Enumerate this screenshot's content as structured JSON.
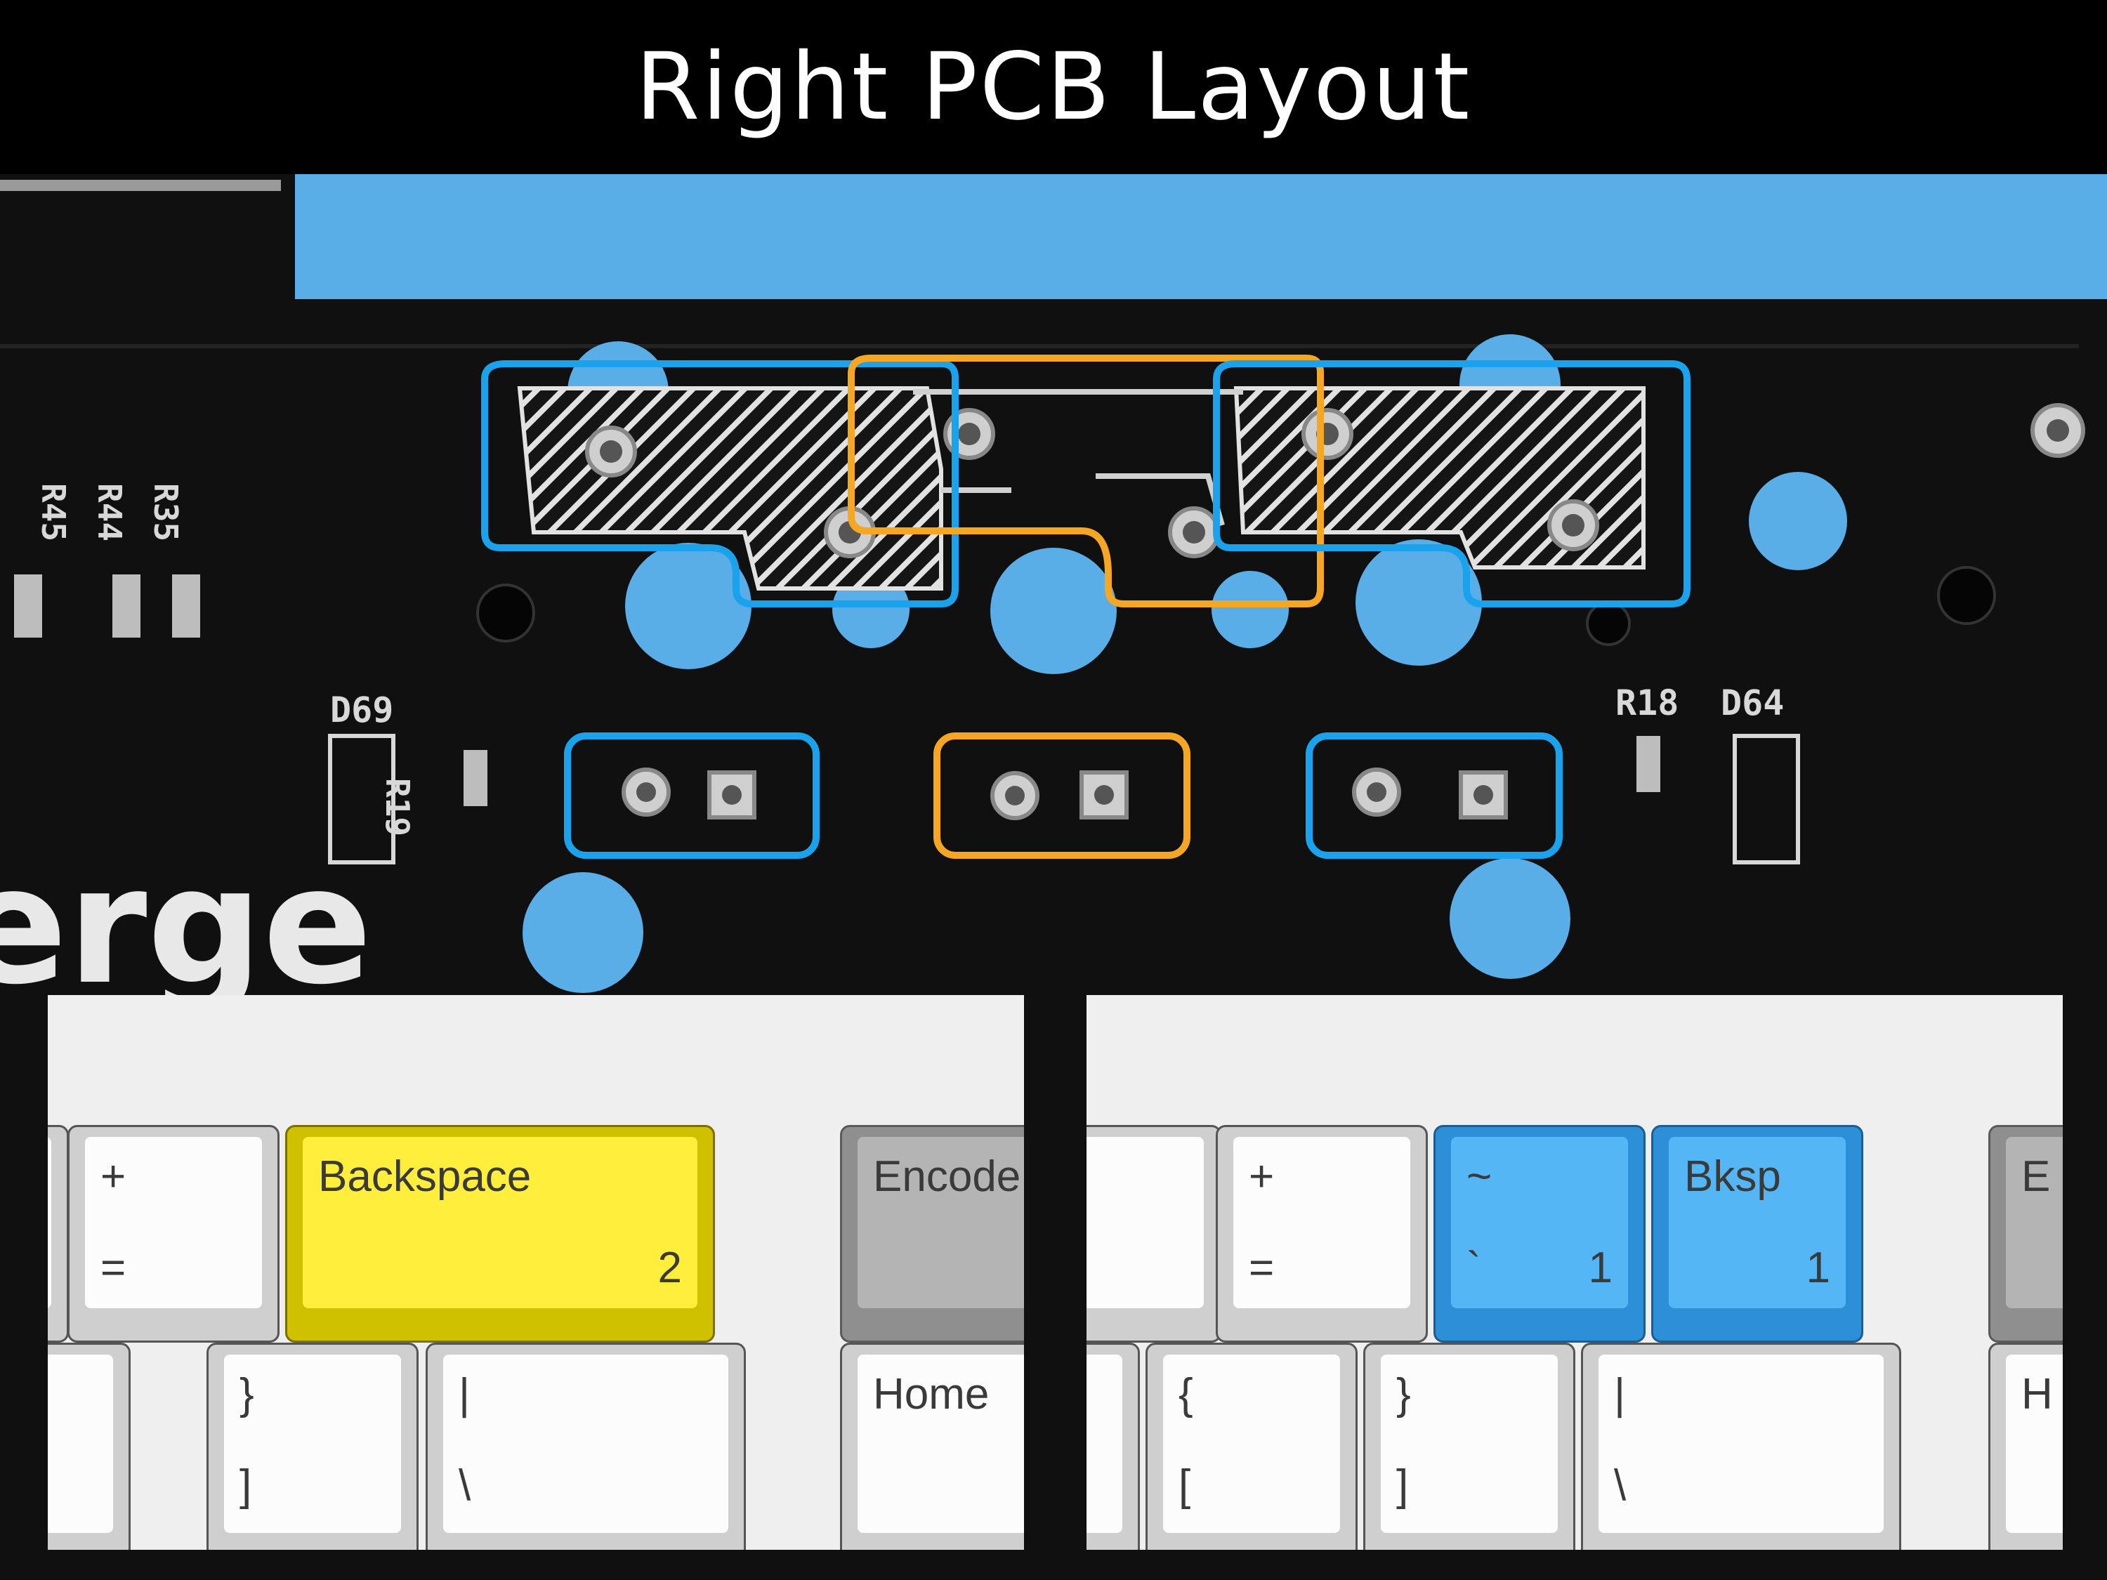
{
  "title": "Right PCB Layout",
  "silkscreen": {
    "d69": "D69",
    "r19": "R19",
    "r45": "R45",
    "r44": "R44",
    "r35": "R35",
    "r18": "R18",
    "d64": "D64",
    "logo_fragment": "erge"
  },
  "highlight_colors": {
    "blue": "#1aa3ec",
    "orange": "#f5a623",
    "accent_fill": "#5aaee8"
  },
  "left_panel": {
    "key_plus": {
      "top": "+",
      "bottom": "="
    },
    "key_backspace": {
      "label": "Backspace",
      "size": "2"
    },
    "key_encoder": {
      "label": "Encode"
    },
    "key_rbrace": {
      "top": "}",
      "bottom": "]"
    },
    "key_pipe": {
      "top": "|",
      "bottom": "\\"
    },
    "key_home": {
      "label": "Home"
    }
  },
  "right_panel": {
    "key_plus": {
      "top": "+",
      "bottom": "="
    },
    "key_tilde": {
      "top": "~",
      "bottom": "`",
      "size": "1"
    },
    "key_bksp": {
      "label": "Bksp",
      "size": "1"
    },
    "key_encoder": {
      "label": "E"
    },
    "key_lbrace": {
      "top": "{",
      "bottom": "["
    },
    "key_rbrace": {
      "top": "}",
      "bottom": "]"
    },
    "key_pipe": {
      "top": "|",
      "bottom": "\\"
    },
    "key_home": {
      "label": "H"
    }
  }
}
